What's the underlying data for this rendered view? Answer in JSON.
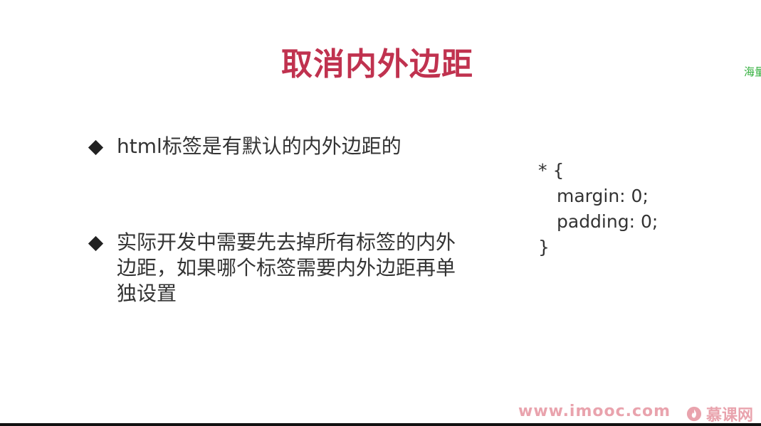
{
  "slide": {
    "title": "取消内外边距",
    "side_note": "海量",
    "bullets": [
      {
        "text": "html标签是有默认的内外边距的"
      },
      {
        "text": "实际开发中需要先去掉所有标签的内外边距，如果哪个标签需要内外边距再单独设置"
      }
    ],
    "code": {
      "line1": "* {",
      "line2": "margin: 0;",
      "line3": "padding: 0;",
      "line4": "}"
    },
    "watermark": {
      "url": "www.imooc.com",
      "brand": "慕课网",
      "icon": "flame-icon"
    },
    "colors": {
      "title": "#c0324f",
      "side_note": "#2fae3a",
      "watermark": "#e9a3ad"
    }
  }
}
